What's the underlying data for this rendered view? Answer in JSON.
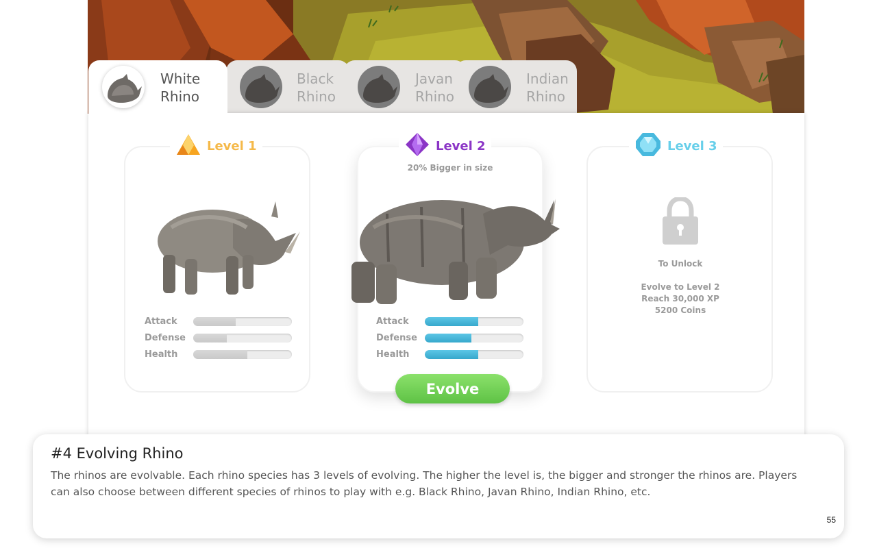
{
  "tabs": [
    {
      "label": "White\nRhino",
      "active": true
    },
    {
      "label": "Black\nRhino",
      "active": false
    },
    {
      "label": "Javan\nRhino",
      "active": false
    },
    {
      "label": "Indian\nRhino",
      "active": false
    }
  ],
  "levels": [
    {
      "title": "Level 1",
      "color": "#f5b949",
      "icon": "amber-triangle-gem-icon",
      "subtitle": "",
      "stats": [
        {
          "label": "Attack",
          "value": 0.43
        },
        {
          "label": "Defense",
          "value": 0.34
        },
        {
          "label": "Health",
          "value": 0.55
        }
      ]
    },
    {
      "title": "Level 2",
      "color": "#8b35c6",
      "icon": "purple-diamond-gem-icon",
      "subtitle": "20% Bigger in size",
      "stats": [
        {
          "label": "Attack",
          "value": 0.54
        },
        {
          "label": "Defense",
          "value": 0.47
        },
        {
          "label": "Health",
          "value": 0.54
        }
      ],
      "action": "Evolve"
    },
    {
      "title": "Level 3",
      "color": "#67cfea",
      "icon": "cyan-crystal-gem-icon",
      "locked": true,
      "unlock_title": "To Unlock",
      "requirements": [
        "Evolve to Level 2",
        "Reach 30,000 XP",
        "5200 Coins"
      ]
    }
  ],
  "caption": {
    "title": "#4 Evolving Rhino",
    "body": "The rhinos are evolvable. Each rhino species has 3 levels of evolving. The higher the level is, the bigger and stronger the rhinos are. Players can also choose between different species of rhinos to play with e.g. Black Rhino, Javan Rhino, Indian Rhino, etc.",
    "page_number": "55"
  },
  "colors": {
    "accent_green": "#6ccf52",
    "stat_blue": "#37a8cc",
    "text_grey": "#9a9a9a"
  }
}
